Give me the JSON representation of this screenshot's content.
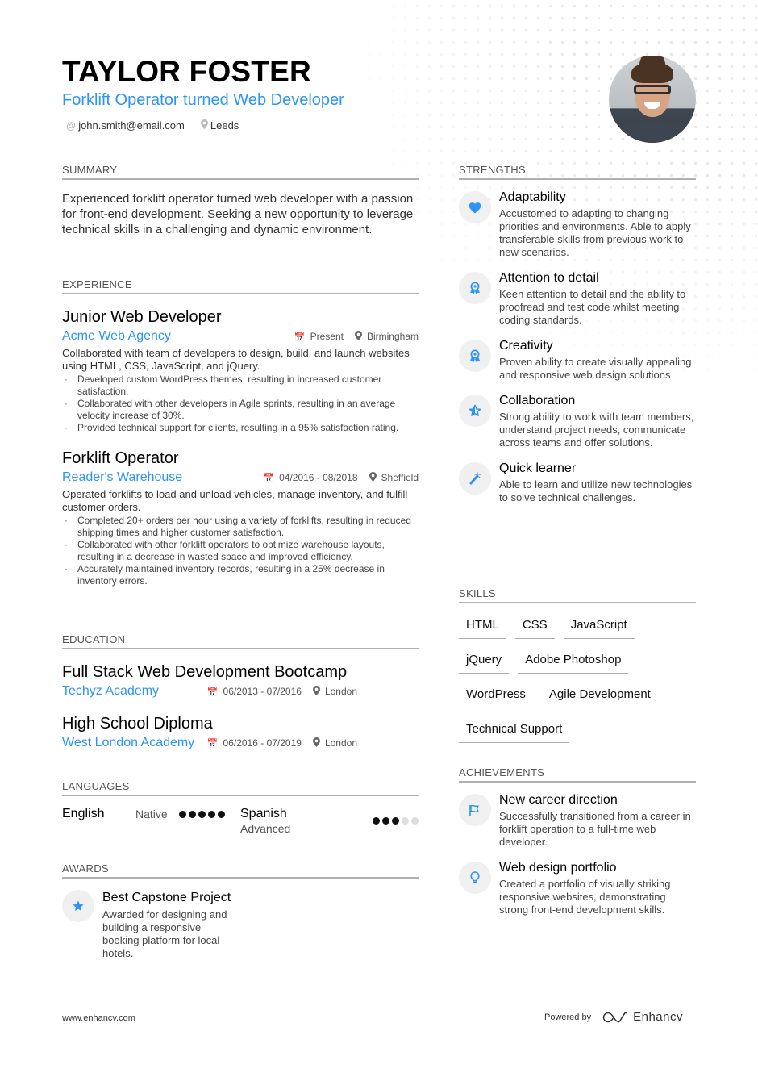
{
  "header": {
    "name": "TAYLOR FOSTER",
    "title": "Forklift Operator turned Web Developer",
    "email": "john.smith@email.com",
    "location": "Leeds",
    "accent_color": "#2e94f5"
  },
  "summary": {
    "heading": "SUMMARY",
    "text": "Experienced forklift operator turned web developer with a passion for front-end development. Seeking a new opportunity to leverage technical skills in a challenging and dynamic environment."
  },
  "experience": {
    "heading": "EXPERIENCE",
    "jobs": [
      {
        "title": "Junior Web Developer",
        "company": "Acme Web Agency",
        "dates": "Present",
        "location": "Birmingham",
        "description": "Collaborated with team of developers to design, build, and launch websites using HTML, CSS, JavaScript, and jQuery.",
        "bullets": [
          "Developed custom WordPress themes, resulting in increased customer satisfaction.",
          "Collaborated with other developers in Agile sprints, resulting in an average velocity increase of 30%.",
          "Provided technical support for clients, resulting in a 95% satisfaction rating."
        ]
      },
      {
        "title": "Forklift Operator",
        "company": "Reader's Warehouse",
        "dates": "04/2016 - 08/2018",
        "location": "Sheffield",
        "description": "Operated forklifts to load and unload vehicles, manage inventory, and fulfill customer orders.",
        "bullets": [
          "Completed 20+ orders per hour using a variety of forklifts, resulting in reduced shipping times and higher customer satisfaction.",
          "Collaborated with other forklift operators to optimize warehouse layouts, resulting in a decrease in wasted space and improved efficiency.",
          "Accurately maintained inventory records, resulting in a 25% decrease in inventory errors."
        ]
      }
    ]
  },
  "education": {
    "heading": "EDUCATION",
    "items": [
      {
        "degree": "Full Stack Web Development Bootcamp",
        "school": "Techyz Academy",
        "dates": "06/2013 - 07/2016",
        "location": "London"
      },
      {
        "degree": "High School Diploma",
        "school": "West London Academy",
        "dates": "06/2016 - 07/2019",
        "location": "London"
      }
    ]
  },
  "languages": {
    "heading": "LANGUAGES",
    "items": [
      {
        "name": "English",
        "level": "Native",
        "rating": 5,
        "max": 5
      },
      {
        "name": "Spanish",
        "level": "Advanced",
        "rating": 3,
        "max": 5
      }
    ]
  },
  "awards": {
    "heading": "AWARDS",
    "items": [
      {
        "icon": "star-icon",
        "title": "Best Capstone Project",
        "description": "Awarded for designing and building a responsive booking platform for local hotels."
      }
    ]
  },
  "strengths": {
    "heading": "STRENGTHS",
    "items": [
      {
        "icon": "heart-icon",
        "title": "Adaptability",
        "description": "Accustomed to adapting to changing priorities and environments. Able to apply transferable skills from previous work to new scenarios."
      },
      {
        "icon": "award-ribbon-icon",
        "title": "Attention to detail",
        "description": "Keen attention to detail and the ability to proofread and test code whilst meeting coding standards."
      },
      {
        "icon": "award-ribbon-icon",
        "title": "Creativity",
        "description": "Proven ability to create visually appealing and responsive web design solutions"
      },
      {
        "icon": "star-half-icon",
        "title": "Collaboration",
        "description": "Strong ability to work with team members, understand project needs, communicate across teams and offer solutions."
      },
      {
        "icon": "magic-wand-icon",
        "title": "Quick learner",
        "description": "Able to learn and utilize new technologies to solve technical challenges."
      }
    ]
  },
  "skills": {
    "heading": "SKILLS",
    "items": [
      "HTML",
      "CSS",
      "JavaScript",
      "jQuery",
      "Adobe Photoshop",
      "WordPress",
      "Agile Development",
      "Technical Support"
    ]
  },
  "achievements": {
    "heading": "ACHIEVEMENTS",
    "items": [
      {
        "icon": "flag-icon",
        "title": "New career direction",
        "description": "Successfully transitioned from a career in forklift operation to a full-time web developer."
      },
      {
        "icon": "lightbulb-icon",
        "title": "Web design portfolio",
        "description": "Created a portfolio of visually striking responsive websites, demonstrating strong front-end development skills."
      }
    ]
  },
  "footer": {
    "website": "www.enhancv.com",
    "powered_by": "Powered by",
    "brand": "Enhancv"
  }
}
